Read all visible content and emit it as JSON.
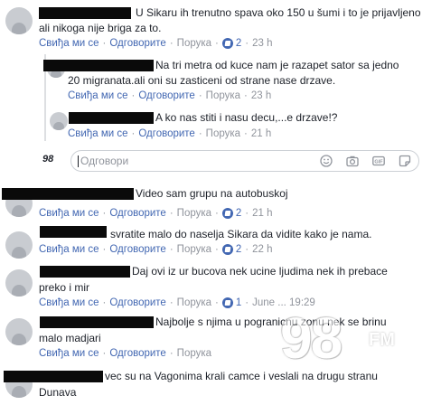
{
  "comments": [
    {
      "lines": [
        "U Sikaru ih trenutno spava oko 150 u šumi i to je prijavljeno",
        "ali nikoga nije briga za to."
      ],
      "like": "Свиђа ми се",
      "reply": "Одговорите",
      "message": "Порука",
      "count": "2",
      "time": "23 h"
    },
    {
      "lines": [
        "Na tri metra od kuce nam je razapet sator sa jedno",
        "20 migranata.ali oni su zasticeni od strane nase drzave."
      ],
      "like": "Свиђа ми се",
      "reply": "Одговорите",
      "message": "Порука",
      "time": "23 h"
    },
    {
      "lines": [
        "A ko nas stiti i nasu decu,...e drzave!?"
      ],
      "like": "Свиђа ми се",
      "reply": "Одговорите",
      "message": "Порука",
      "time": "21 h"
    },
    {
      "lines": [
        "Video sam grupu na autobuskoj"
      ],
      "like": "Свиђа ми се",
      "reply": "Одговорите",
      "message": "Порука",
      "count": "2",
      "time": "21 h"
    },
    {
      "lines": [
        "svratite malo do naselja Sikara da vidite kako je nama."
      ],
      "like": "Свиђа ми се",
      "reply": "Одговорите",
      "message": "Порука",
      "count": "2",
      "time": "22 h"
    },
    {
      "lines": [
        "Daj ovi iz ur bucova nek ucine ljudima nek ih prebace",
        "preko i mir"
      ],
      "like": "Свиђа ми се",
      "reply": "Одговорите",
      "message": "Порука",
      "count": "1",
      "time": "June ... 19:29"
    },
    {
      "lines": [
        "Najbolje s njima u pogranicnu zonu nek se brinu",
        "malo madjari"
      ],
      "like": "Свиђа ми се",
      "reply": "Одговорите",
      "message": "Порука"
    },
    {
      "lines": [
        "vec su na Vagonima krali camce i veslali na drugu stranu",
        "Dunava"
      ]
    }
  ],
  "reply_input": {
    "placeholder": "Одговори"
  },
  "input_logo": "98",
  "input_icons": [
    "emoji-icon",
    "camera-icon",
    "gif-icon",
    "sticker-icon"
  ],
  "watermark": {
    "number": "98",
    "band": "FM"
  },
  "colors": {
    "link": "#4267b2",
    "muted": "#90949c",
    "text": "#1d2129",
    "like_badge": "#4267b2"
  }
}
